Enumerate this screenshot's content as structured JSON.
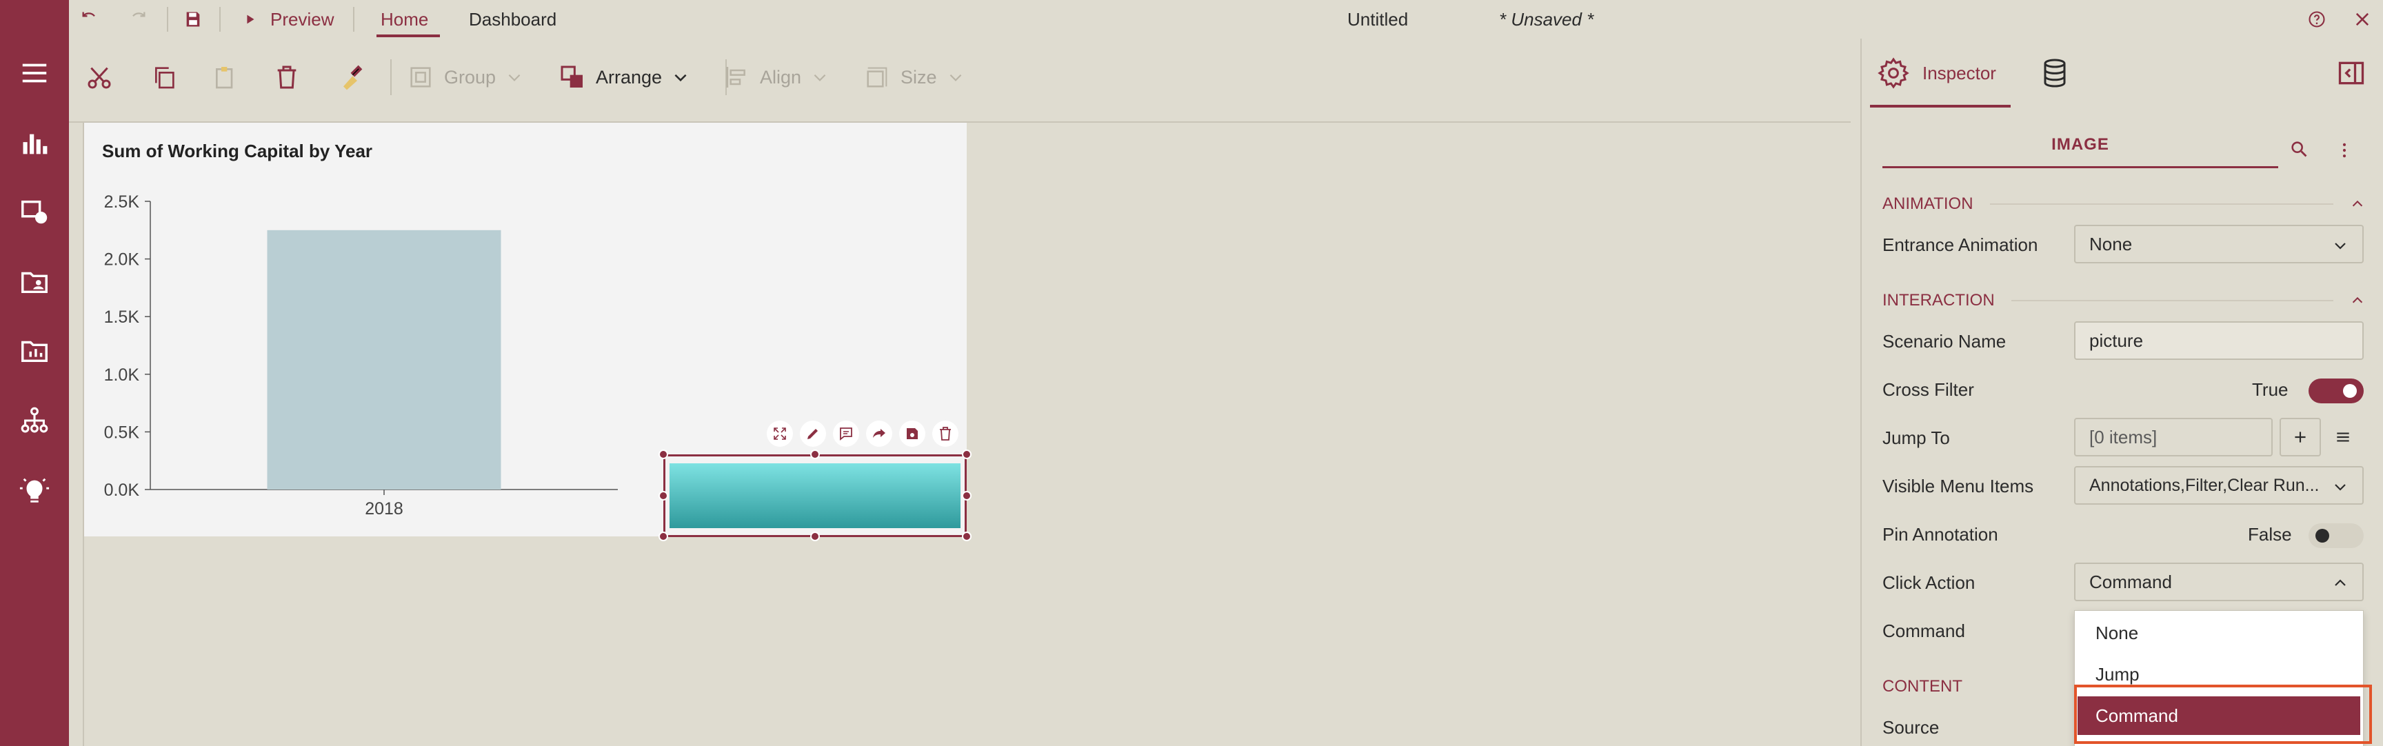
{
  "app": {
    "preview_label": "Preview",
    "tabs": [
      {
        "label": "Home"
      },
      {
        "label": "Dashboard"
      }
    ],
    "document_title": "Untitled",
    "unsaved_label": "* Unsaved *"
  },
  "toolbar": {
    "group_label": "Group",
    "arrange_label": "Arrange",
    "align_label": "Align",
    "size_label": "Size"
  },
  "chart_data": {
    "type": "bar",
    "title": "Sum of Working Capital by Year",
    "categories": [
      "2018"
    ],
    "values": [
      2250
    ],
    "ylim": [
      0,
      2500
    ],
    "yticks": [
      "0.0K",
      "0.5K",
      "1.0K",
      "1.5K",
      "2.0K",
      "2.5K"
    ],
    "bar_color": "#b9ced3",
    "grid": false
  },
  "panel": {
    "inspector_label": "Inspector",
    "image_tab": "IMAGE",
    "sections": {
      "animation": "ANIMATION",
      "interaction": "INTERACTION",
      "content": "CONTENT"
    },
    "fields": {
      "entrance_animation": {
        "label": "Entrance Animation",
        "value": "None"
      },
      "scenario_name": {
        "label": "Scenario Name",
        "value": "picture"
      },
      "cross_filter": {
        "label": "Cross Filter",
        "value": "True"
      },
      "jump_to": {
        "label": "Jump To",
        "value": "[0 items]"
      },
      "visible_menu_items": {
        "label": "Visible Menu Items",
        "value": "Annotations,Filter,Clear Run..."
      },
      "pin_annotation": {
        "label": "Pin Annotation",
        "value": "False"
      },
      "click_action": {
        "label": "Click Action",
        "value": "Command"
      },
      "command": {
        "label": "Command"
      },
      "source": {
        "label": "Source"
      }
    },
    "click_action_options": [
      "None",
      "Jump",
      "Command"
    ]
  },
  "colors": {
    "brand": "#8b2f42",
    "background": "#dfdcd0",
    "highlight": "#e2542a"
  }
}
